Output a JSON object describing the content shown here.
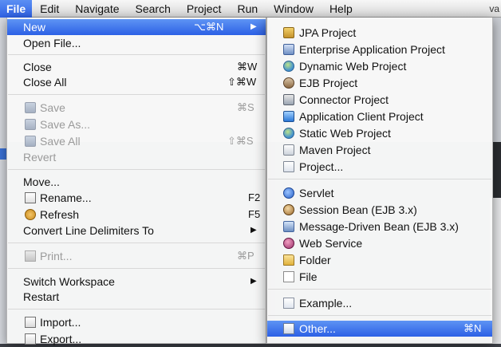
{
  "menubar": {
    "items": [
      "File",
      "Edit",
      "Navigate",
      "Search",
      "Project",
      "Run",
      "Window",
      "Help"
    ],
    "tail": "va"
  },
  "file_menu": {
    "new": {
      "label": "New",
      "shortcut": "⌥⌘N"
    },
    "open_file": {
      "label": "Open File..."
    },
    "close": {
      "label": "Close",
      "shortcut": "⌘W"
    },
    "close_all": {
      "label": "Close All",
      "shortcut": "⇧⌘W"
    },
    "save": {
      "label": "Save",
      "shortcut": "⌘S"
    },
    "save_as": {
      "label": "Save As..."
    },
    "save_all": {
      "label": "Save All",
      "shortcut": "⇧⌘S"
    },
    "revert": {
      "label": "Revert"
    },
    "move": {
      "label": "Move..."
    },
    "rename": {
      "label": "Rename...",
      "shortcut": "F2"
    },
    "refresh": {
      "label": "Refresh",
      "shortcut": "F5"
    },
    "convert": {
      "label": "Convert Line Delimiters To"
    },
    "print": {
      "label": "Print...",
      "shortcut": "⌘P"
    },
    "switch_workspace": {
      "label": "Switch Workspace"
    },
    "restart": {
      "label": "Restart"
    },
    "import": {
      "label": "Import..."
    },
    "export": {
      "label": "Export..."
    }
  },
  "new_submenu": {
    "items": [
      {
        "label": "JPA Project",
        "icon": "jar-icon"
      },
      {
        "label": "Enterprise Application Project",
        "icon": "ear-icon"
      },
      {
        "label": "Dynamic Web Project",
        "icon": "globe-icon"
      },
      {
        "label": "EJB Project",
        "icon": "bean-icon"
      },
      {
        "label": "Connector Project",
        "icon": "plug-icon"
      },
      {
        "label": "Application Client Project",
        "icon": "app-icon"
      },
      {
        "label": "Static Web Project",
        "icon": "globe-icon"
      },
      {
        "label": "Maven Project",
        "icon": "maven-icon"
      },
      {
        "label": "Project...",
        "icon": "project-icon"
      },
      {
        "label": "Servlet",
        "icon": "servlet-icon"
      },
      {
        "label": "Session Bean (EJB 3.x)",
        "icon": "session-bean-icon"
      },
      {
        "label": "Message-Driven Bean (EJB 3.x)",
        "icon": "message-bean-icon"
      },
      {
        "label": "Web Service",
        "icon": "web-service-icon"
      },
      {
        "label": "Folder",
        "icon": "folder-icon"
      },
      {
        "label": "File",
        "icon": "file-icon"
      },
      {
        "label": "Example...",
        "icon": "example-icon"
      },
      {
        "label": "Other...",
        "icon": "other-icon",
        "shortcut": "⌘N"
      }
    ]
  },
  "colors": {
    "selection": "#3a6fe8",
    "menu_bg": "#f8f8f8"
  }
}
